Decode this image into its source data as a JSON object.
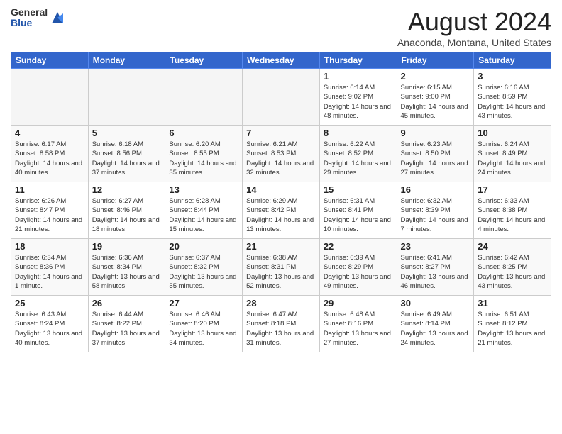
{
  "header": {
    "logo_general": "General",
    "logo_blue": "Blue",
    "title": "August 2024",
    "subtitle": "Anaconda, Montana, United States"
  },
  "days_of_week": [
    "Sunday",
    "Monday",
    "Tuesday",
    "Wednesday",
    "Thursday",
    "Friday",
    "Saturday"
  ],
  "weeks": [
    [
      {
        "day": "",
        "info": ""
      },
      {
        "day": "",
        "info": ""
      },
      {
        "day": "",
        "info": ""
      },
      {
        "day": "",
        "info": ""
      },
      {
        "day": "1",
        "info": "Sunrise: 6:14 AM\nSunset: 9:02 PM\nDaylight: 14 hours\nand 48 minutes."
      },
      {
        "day": "2",
        "info": "Sunrise: 6:15 AM\nSunset: 9:00 PM\nDaylight: 14 hours\nand 45 minutes."
      },
      {
        "day": "3",
        "info": "Sunrise: 6:16 AM\nSunset: 8:59 PM\nDaylight: 14 hours\nand 43 minutes."
      }
    ],
    [
      {
        "day": "4",
        "info": "Sunrise: 6:17 AM\nSunset: 8:58 PM\nDaylight: 14 hours\nand 40 minutes."
      },
      {
        "day": "5",
        "info": "Sunrise: 6:18 AM\nSunset: 8:56 PM\nDaylight: 14 hours\nand 37 minutes."
      },
      {
        "day": "6",
        "info": "Sunrise: 6:20 AM\nSunset: 8:55 PM\nDaylight: 14 hours\nand 35 minutes."
      },
      {
        "day": "7",
        "info": "Sunrise: 6:21 AM\nSunset: 8:53 PM\nDaylight: 14 hours\nand 32 minutes."
      },
      {
        "day": "8",
        "info": "Sunrise: 6:22 AM\nSunset: 8:52 PM\nDaylight: 14 hours\nand 29 minutes."
      },
      {
        "day": "9",
        "info": "Sunrise: 6:23 AM\nSunset: 8:50 PM\nDaylight: 14 hours\nand 27 minutes."
      },
      {
        "day": "10",
        "info": "Sunrise: 6:24 AM\nSunset: 8:49 PM\nDaylight: 14 hours\nand 24 minutes."
      }
    ],
    [
      {
        "day": "11",
        "info": "Sunrise: 6:26 AM\nSunset: 8:47 PM\nDaylight: 14 hours\nand 21 minutes."
      },
      {
        "day": "12",
        "info": "Sunrise: 6:27 AM\nSunset: 8:46 PM\nDaylight: 14 hours\nand 18 minutes."
      },
      {
        "day": "13",
        "info": "Sunrise: 6:28 AM\nSunset: 8:44 PM\nDaylight: 14 hours\nand 15 minutes."
      },
      {
        "day": "14",
        "info": "Sunrise: 6:29 AM\nSunset: 8:42 PM\nDaylight: 14 hours\nand 13 minutes."
      },
      {
        "day": "15",
        "info": "Sunrise: 6:31 AM\nSunset: 8:41 PM\nDaylight: 14 hours\nand 10 minutes."
      },
      {
        "day": "16",
        "info": "Sunrise: 6:32 AM\nSunset: 8:39 PM\nDaylight: 14 hours\nand 7 minutes."
      },
      {
        "day": "17",
        "info": "Sunrise: 6:33 AM\nSunset: 8:38 PM\nDaylight: 14 hours\nand 4 minutes."
      }
    ],
    [
      {
        "day": "18",
        "info": "Sunrise: 6:34 AM\nSunset: 8:36 PM\nDaylight: 14 hours\nand 1 minute."
      },
      {
        "day": "19",
        "info": "Sunrise: 6:36 AM\nSunset: 8:34 PM\nDaylight: 13 hours\nand 58 minutes."
      },
      {
        "day": "20",
        "info": "Sunrise: 6:37 AM\nSunset: 8:32 PM\nDaylight: 13 hours\nand 55 minutes."
      },
      {
        "day": "21",
        "info": "Sunrise: 6:38 AM\nSunset: 8:31 PM\nDaylight: 13 hours\nand 52 minutes."
      },
      {
        "day": "22",
        "info": "Sunrise: 6:39 AM\nSunset: 8:29 PM\nDaylight: 13 hours\nand 49 minutes."
      },
      {
        "day": "23",
        "info": "Sunrise: 6:41 AM\nSunset: 8:27 PM\nDaylight: 13 hours\nand 46 minutes."
      },
      {
        "day": "24",
        "info": "Sunrise: 6:42 AM\nSunset: 8:25 PM\nDaylight: 13 hours\nand 43 minutes."
      }
    ],
    [
      {
        "day": "25",
        "info": "Sunrise: 6:43 AM\nSunset: 8:24 PM\nDaylight: 13 hours\nand 40 minutes."
      },
      {
        "day": "26",
        "info": "Sunrise: 6:44 AM\nSunset: 8:22 PM\nDaylight: 13 hours\nand 37 minutes."
      },
      {
        "day": "27",
        "info": "Sunrise: 6:46 AM\nSunset: 8:20 PM\nDaylight: 13 hours\nand 34 minutes."
      },
      {
        "day": "28",
        "info": "Sunrise: 6:47 AM\nSunset: 8:18 PM\nDaylight: 13 hours\nand 31 minutes."
      },
      {
        "day": "29",
        "info": "Sunrise: 6:48 AM\nSunset: 8:16 PM\nDaylight: 13 hours\nand 27 minutes."
      },
      {
        "day": "30",
        "info": "Sunrise: 6:49 AM\nSunset: 8:14 PM\nDaylight: 13 hours\nand 24 minutes."
      },
      {
        "day": "31",
        "info": "Sunrise: 6:51 AM\nSunset: 8:12 PM\nDaylight: 13 hours\nand 21 minutes."
      }
    ]
  ]
}
